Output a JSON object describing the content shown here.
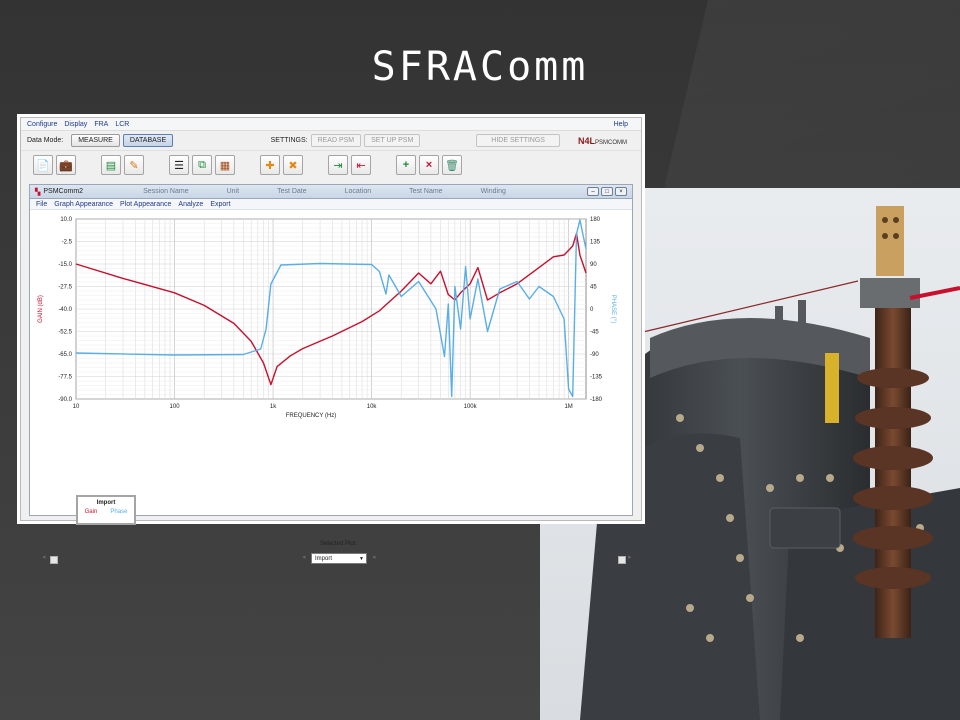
{
  "slide": {
    "title": "SFRAComm"
  },
  "app": {
    "menu": [
      "Configure",
      "Display",
      "FRA",
      "LCR"
    ],
    "help": "Help",
    "data_mode_label": "Data Mode:",
    "measure_btn": "MEASURE",
    "database_btn": "DATABASE",
    "settings_label": "SETTINGS:",
    "read_psm_btn": "READ PSM",
    "setup_psm_btn": "SET UP PSM",
    "hide_settings_btn": "HIDE SETTINGS",
    "logo_brand": "N4L",
    "logo_product": "PSMCOMM"
  },
  "child": {
    "title": "PSMComm2",
    "ghost_tabs": [
      "Session Name",
      "Unit",
      "Test Date",
      "Location",
      "Test Name",
      "Winding"
    ],
    "menu": [
      "File",
      "Graph Appearance",
      "Plot Appearance",
      "Analyze",
      "Export"
    ],
    "legend": {
      "title": "Import",
      "gain": "Gain",
      "phase": "Phase"
    },
    "selected_plot_label": "Selected Plot:",
    "selected_plot_value": "Import"
  },
  "chart_data": {
    "type": "line",
    "xlabel": "FREQUENCY (Hz)",
    "ylabel_left": "GAIN (dB)",
    "ylabel_right": "PHASE (°)",
    "xscale": "log",
    "xlim": [
      10,
      1500000
    ],
    "ylim_left": [
      -90,
      10
    ],
    "ylim_right": [
      -180,
      180
    ],
    "x_ticks": [
      {
        "v": 10,
        "label": "10"
      },
      {
        "v": 100,
        "label": "100"
      },
      {
        "v": 1000,
        "label": "1k"
      },
      {
        "v": 10000,
        "label": "10k"
      },
      {
        "v": 100000,
        "label": "100k"
      },
      {
        "v": 1000000,
        "label": "1M"
      }
    ],
    "y_ticks_left": [
      "10.0",
      "-2.5",
      "-15.0",
      "-27.5",
      "-40.0",
      "-52.5",
      "-65.0",
      "-77.5",
      "-90.0"
    ],
    "y_ticks_right": [
      "180",
      "135",
      "90",
      "45",
      "0",
      "-45",
      "-90",
      "-135",
      "-180"
    ],
    "grid": true,
    "colors": {
      "gain": "#c8102e",
      "phase": "#5aaee6"
    },
    "series": [
      {
        "name": "Gain",
        "axis": "left",
        "points": [
          [
            10,
            -15
          ],
          [
            30,
            -23
          ],
          [
            100,
            -31
          ],
          [
            200,
            -38
          ],
          [
            400,
            -48
          ],
          [
            600,
            -58
          ],
          [
            800,
            -70
          ],
          [
            950,
            -82
          ],
          [
            1100,
            -72
          ],
          [
            1500,
            -66
          ],
          [
            2000,
            -62
          ],
          [
            4000,
            -55
          ],
          [
            8000,
            -47
          ],
          [
            12000,
            -41
          ],
          [
            20000,
            -30
          ],
          [
            30000,
            -20
          ],
          [
            40000,
            -26
          ],
          [
            50000,
            -19
          ],
          [
            60000,
            -32
          ],
          [
            70000,
            -35
          ],
          [
            80000,
            -31
          ],
          [
            100000,
            -26
          ],
          [
            120000,
            -17
          ],
          [
            150000,
            -35
          ],
          [
            200000,
            -31
          ],
          [
            300000,
            -26
          ],
          [
            500000,
            -17
          ],
          [
            700000,
            -11
          ],
          [
            900000,
            -10
          ],
          [
            1100000,
            -5
          ],
          [
            1200000,
            2
          ],
          [
            1300000,
            -10
          ],
          [
            1500000,
            -20
          ]
        ]
      },
      {
        "name": "Phase",
        "axis": "right",
        "points": [
          [
            10,
            -88
          ],
          [
            100,
            -92
          ],
          [
            500,
            -91
          ],
          [
            750,
            -80
          ],
          [
            850,
            -40
          ],
          [
            950,
            50
          ],
          [
            1200,
            88
          ],
          [
            3000,
            91
          ],
          [
            10000,
            89
          ],
          [
            12000,
            75
          ],
          [
            14000,
            30
          ],
          [
            15000,
            68
          ],
          [
            20000,
            25
          ],
          [
            30000,
            55
          ],
          [
            45000,
            0
          ],
          [
            55000,
            -95
          ],
          [
            60000,
            10
          ],
          [
            65000,
            -175
          ],
          [
            70000,
            45
          ],
          [
            80000,
            -40
          ],
          [
            90000,
            85
          ],
          [
            100000,
            -20
          ],
          [
            120000,
            60
          ],
          [
            150000,
            -45
          ],
          [
            200000,
            40
          ],
          [
            300000,
            55
          ],
          [
            400000,
            20
          ],
          [
            500000,
            45
          ],
          [
            700000,
            25
          ],
          [
            900000,
            -20
          ],
          [
            1000000,
            -160
          ],
          [
            1100000,
            -175
          ],
          [
            1200000,
            150
          ],
          [
            1300000,
            178
          ],
          [
            1500000,
            120
          ]
        ]
      }
    ]
  }
}
